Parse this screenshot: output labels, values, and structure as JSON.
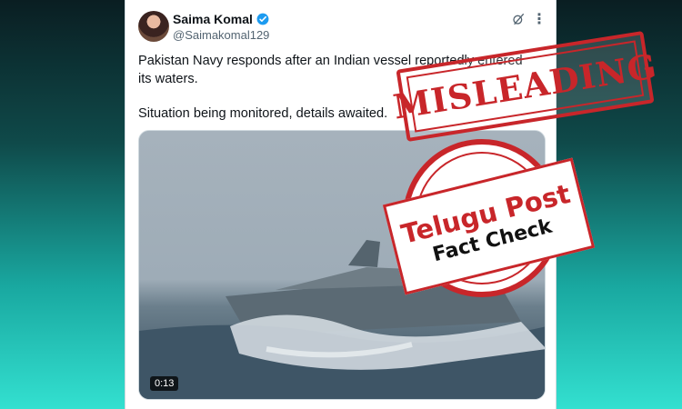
{
  "post": {
    "author_name": "Saima Komal",
    "author_handle": "@Saimakomal129",
    "verified_icon": "verified-badge-icon",
    "text_line1": "Pakistan Navy responds after an Indian vessel reportedly entered its waters.",
    "text_line2": "Situation being monitored, details awaited.",
    "video_duration": "0:13"
  },
  "stamps": {
    "misleading": "MISLEADING",
    "brand": "Telugu Post",
    "fact_check": "Fact Check"
  },
  "colors": {
    "stamp_red": "#c8262a",
    "verified_blue": "#1d9bf0",
    "bg_top": "#0a1e22",
    "bg_bottom": "#33e0d0"
  }
}
